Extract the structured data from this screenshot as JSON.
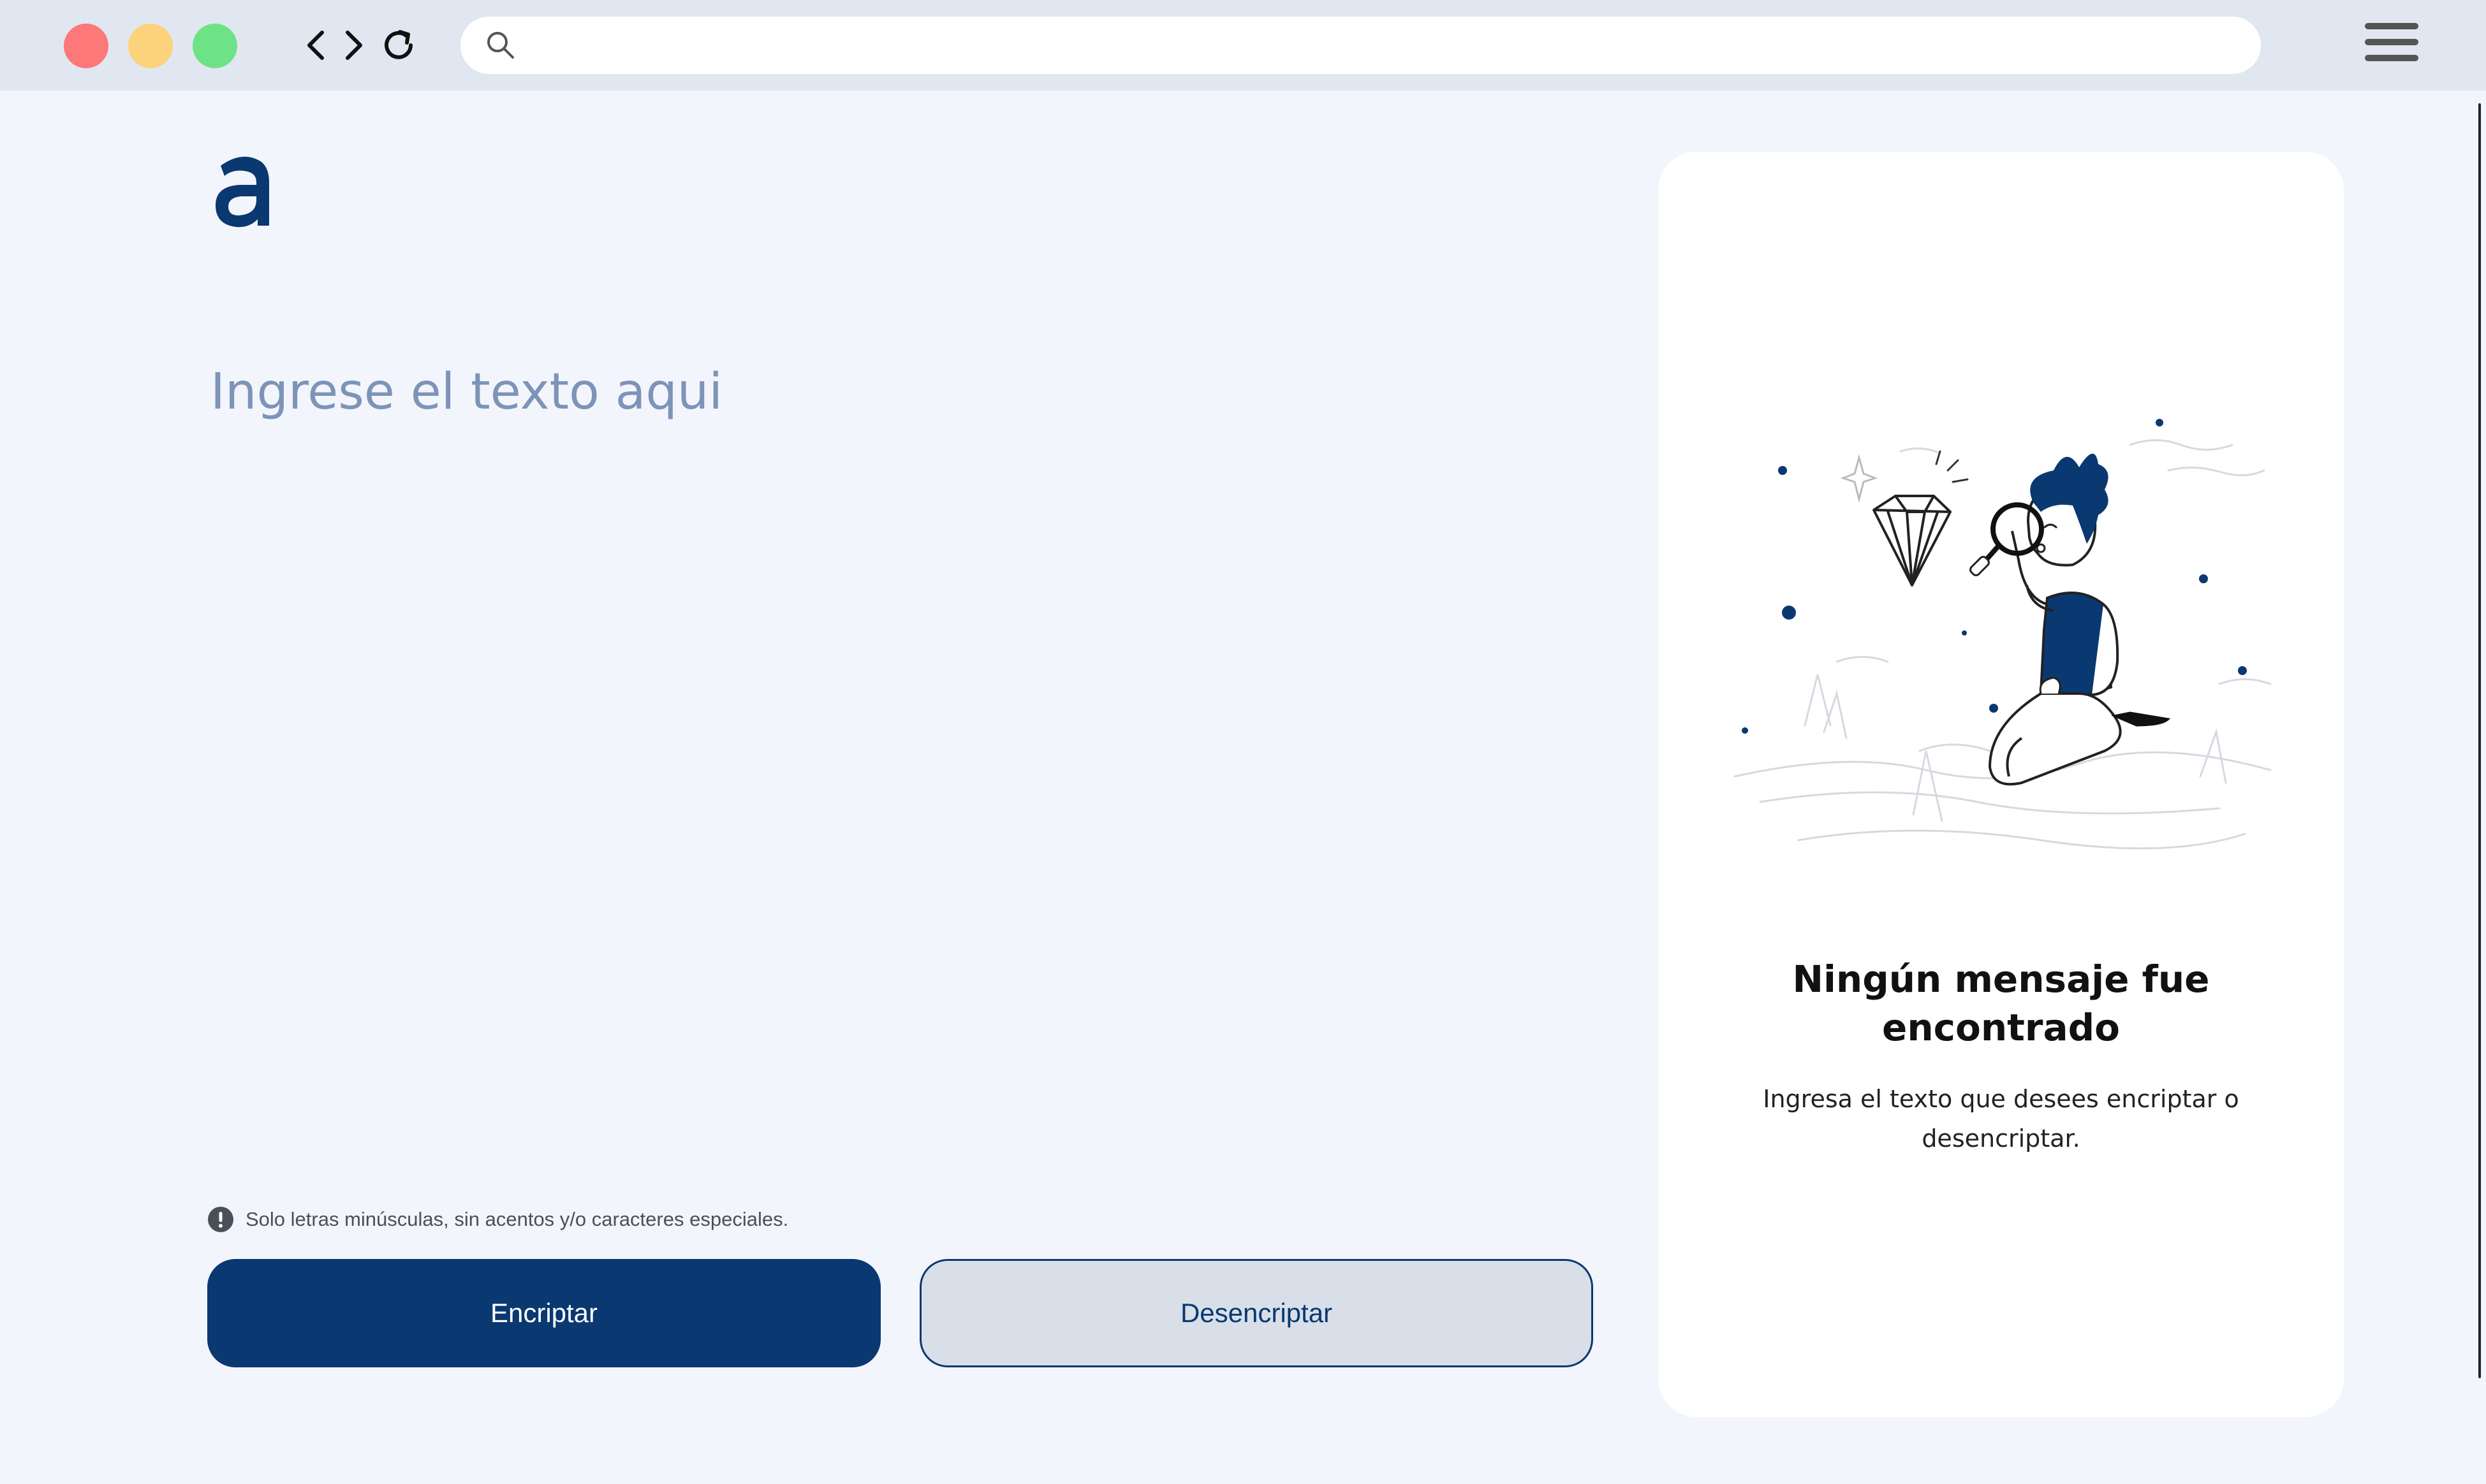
{
  "browser": {
    "url_value": "",
    "icons": [
      "close-dot",
      "minimize-dot",
      "maximize-dot",
      "back-icon",
      "forward-icon",
      "reload-icon",
      "search-icon",
      "hamburger-menu-icon"
    ]
  },
  "app": {
    "logo_icon": "alura-logo-icon",
    "input_placeholder": "Ingrese el texto aqui",
    "input_value": "",
    "warning_text": "Solo letras minúsculas, sin acentos y/o caracteres especiales.",
    "encrypt_label": "Encriptar",
    "decrypt_label": "Desencriptar"
  },
  "output_panel": {
    "illustration_icon": "person-searching-diamond-illustration",
    "title": "Ningún mensaje fue encontrado",
    "subtitle": "Ingresa el texto que desees encriptar o desencriptar."
  },
  "colors": {
    "primary": "#0a3871",
    "background": "#f3f5fc",
    "chrome": "#e1e7f1",
    "placeholder": "#7d94b8",
    "decrypt_bg": "#d8dfe8"
  }
}
